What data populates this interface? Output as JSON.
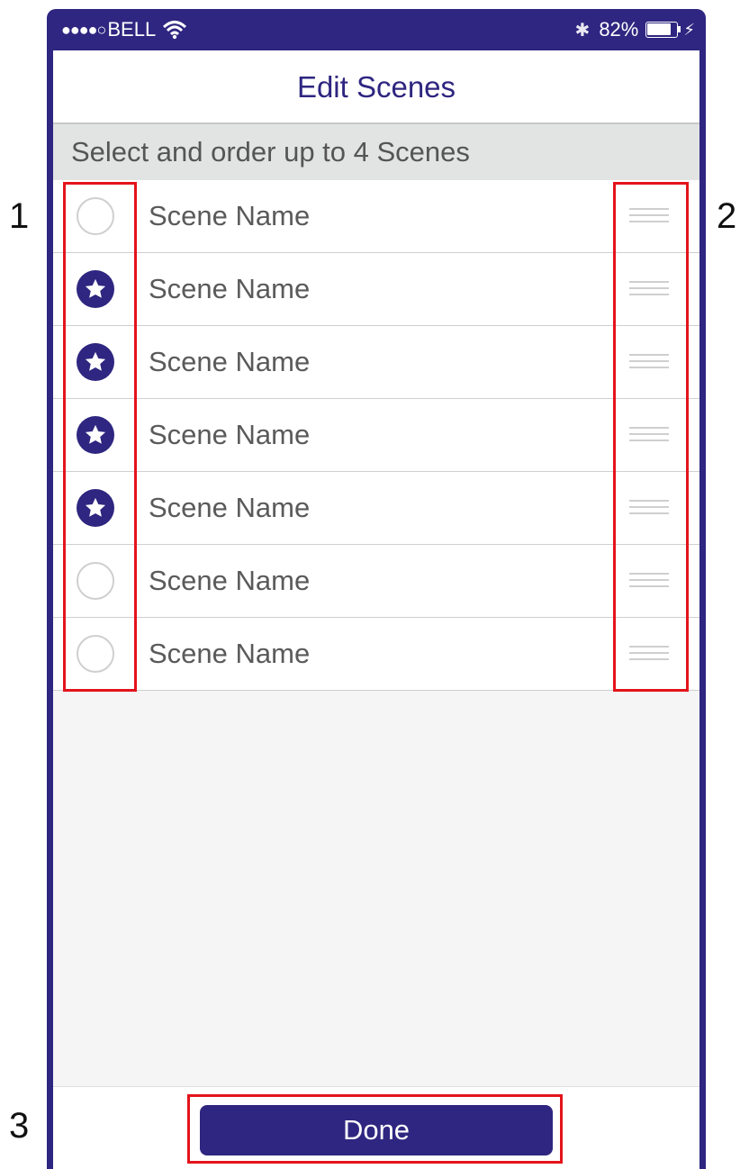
{
  "status_bar": {
    "signal_dots": "●●●●○",
    "carrier": "BELL",
    "battery_percent": "82%",
    "battery_level": 0.82
  },
  "nav": {
    "title": "Edit Scenes"
  },
  "subheader": {
    "text": "Select and order up to 4 Scenes"
  },
  "scenes": [
    {
      "name": "Scene Name",
      "selected": false
    },
    {
      "name": "Scene Name",
      "selected": true
    },
    {
      "name": "Scene Name",
      "selected": true
    },
    {
      "name": "Scene Name",
      "selected": true
    },
    {
      "name": "Scene Name",
      "selected": true
    },
    {
      "name": "Scene Name",
      "selected": false
    },
    {
      "name": "Scene Name",
      "selected": false
    }
  ],
  "footer": {
    "done_label": "Done"
  },
  "annotations": {
    "one": "1",
    "two": "2",
    "three": "3"
  },
  "colors": {
    "brand": "#2e2680",
    "callout": "#e3141b"
  }
}
